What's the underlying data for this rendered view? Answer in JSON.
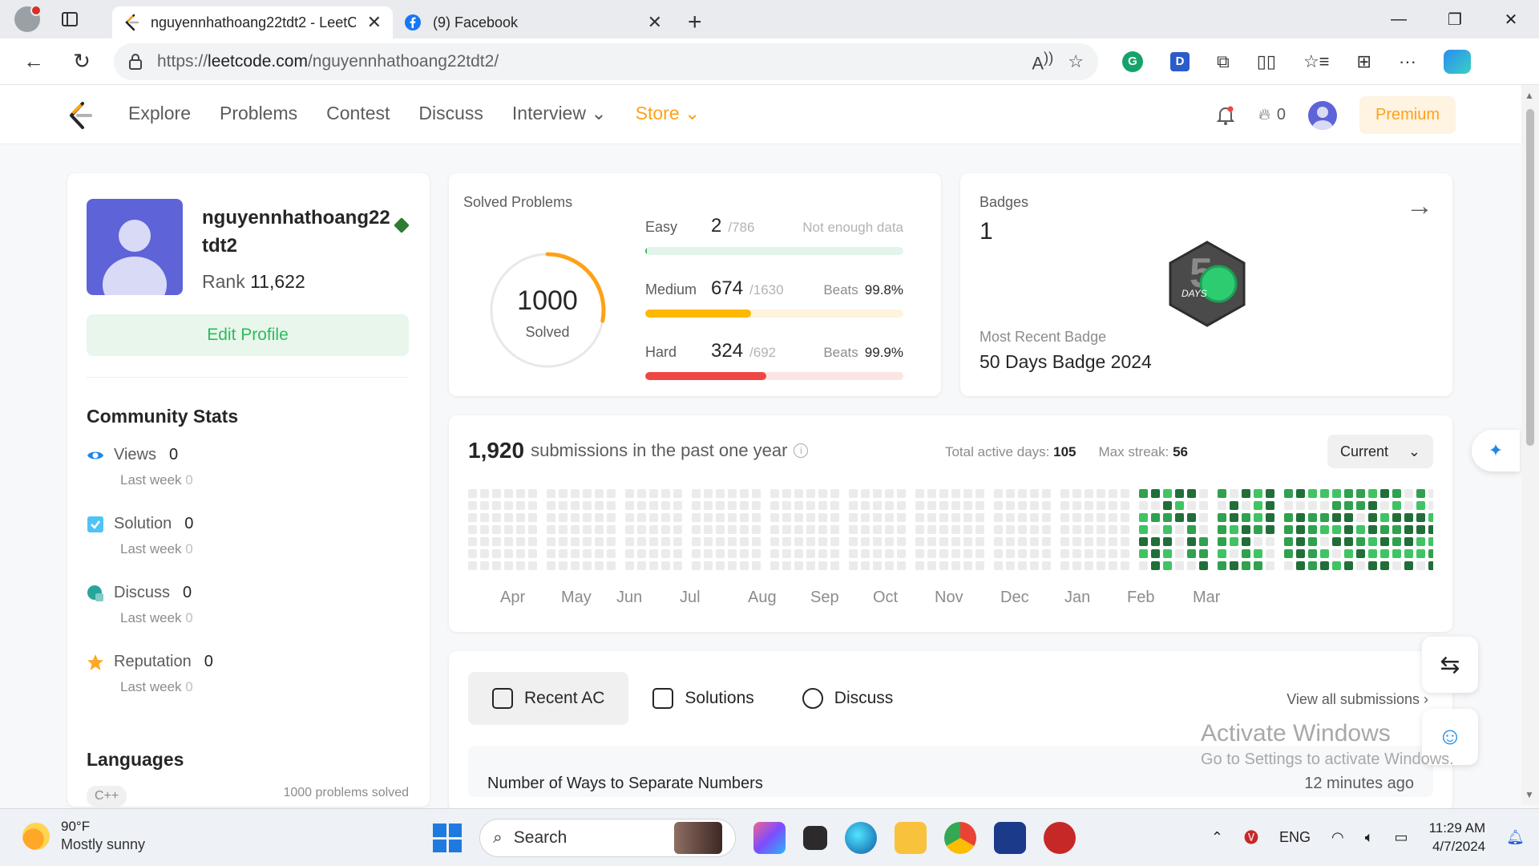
{
  "browser": {
    "tabs": [
      {
        "title": "nguyennhathoang22tdt2 - LeetC",
        "active": true
      },
      {
        "title": "(9) Facebook",
        "active": false
      }
    ],
    "url_prefix": "https://",
    "url_domain": "leetcode.com",
    "url_path": "/nguyennhathoang22tdt2/"
  },
  "nav": {
    "links": [
      "Explore",
      "Problems",
      "Contest",
      "Discuss",
      "Interview",
      "Store"
    ],
    "streak": "0",
    "premium": "Premium"
  },
  "profile": {
    "username": "nguyennhathoang22tdt2",
    "rank_label": "Rank",
    "rank_value": "11,622",
    "edit_label": "Edit Profile",
    "community_title": "Community Stats",
    "stats": [
      {
        "label": "Views",
        "value": "0",
        "last_week_label": "Last week",
        "last_week": "0",
        "color": "#1e88e5"
      },
      {
        "label": "Solution",
        "value": "0",
        "last_week_label": "Last week",
        "last_week": "0",
        "color": "#4fc3f7"
      },
      {
        "label": "Discuss",
        "value": "0",
        "last_week_label": "Last week",
        "last_week": "0",
        "color": "#26a69a"
      },
      {
        "label": "Reputation",
        "value": "0",
        "last_week_label": "Last week",
        "last_week": "0",
        "color": "#ffa726"
      }
    ],
    "languages_title": "Languages",
    "language": "C++",
    "language_solved": "1000 problems solved"
  },
  "solved": {
    "title": "Solved Problems",
    "total": "1000",
    "total_label": "Solved",
    "ring_fraction": 0.28,
    "difficulties": [
      {
        "label": "Easy",
        "count": "2",
        "total": "/786",
        "right": "Not enough data",
        "beats": "",
        "fill": 0.003,
        "color": "#2cbb5d",
        "track": "#e3f5ea"
      },
      {
        "label": "Medium",
        "count": "674",
        "total": "/1630",
        "right": "Beats",
        "beats": "99.8%",
        "fill": 0.41,
        "color": "#ffb800",
        "track": "#fef3dc"
      },
      {
        "label": "Hard",
        "count": "324",
        "total": "/692",
        "right": "Beats",
        "beats": "99.9%",
        "fill": 0.47,
        "color": "#ef4743",
        "track": "#fde4e4"
      }
    ]
  },
  "badges": {
    "title": "Badges",
    "count": "1",
    "most_recent_label": "Most Recent Badge",
    "badge_name": "50 Days Badge 2024",
    "badge_text": "DAYS"
  },
  "submissions": {
    "count": "1,920",
    "text": "submissions in the past one year",
    "active_days_label": "Total active days:",
    "active_days": "105",
    "max_streak_label": "Max streak:",
    "max_streak": "56",
    "period": "Current",
    "months": [
      "Apr",
      "May",
      "Jun",
      "Jul",
      "Aug",
      "Sep",
      "Oct",
      "Nov",
      "Dec",
      "Jan",
      "Feb",
      "Mar"
    ]
  },
  "recent": {
    "tabs": [
      "Recent AC",
      "Solutions",
      "Discuss"
    ],
    "view_all": "View all submissions",
    "items": [
      {
        "title": "Number of Ways to Separate Numbers",
        "time": "12 minutes ago"
      }
    ]
  },
  "watermark": {
    "line1": "Activate Windows",
    "line2": "Go to Settings to activate Windows."
  },
  "taskbar": {
    "temp": "90°F",
    "weather": "Mostly sunny",
    "search": "Search",
    "lang": "ENG",
    "time": "11:29 AM",
    "date": "4/7/2024"
  }
}
